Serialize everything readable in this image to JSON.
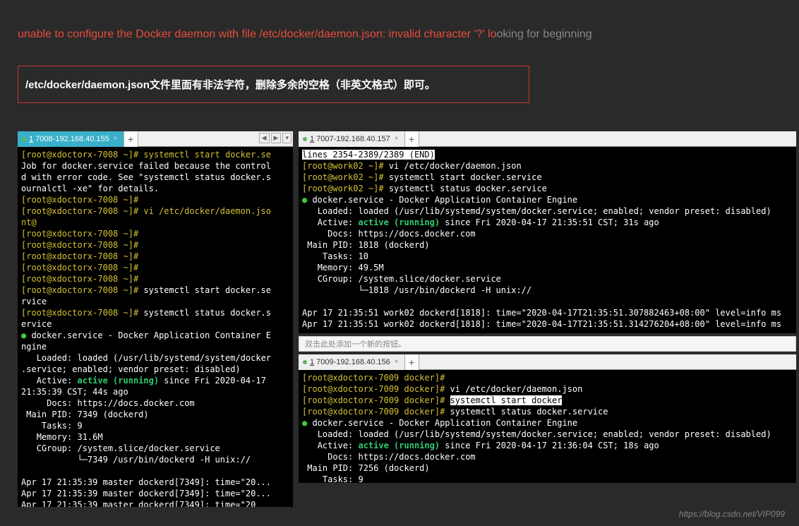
{
  "top": {
    "error_red": "unable to configure the Docker daemon with file /etc/docker/daemon.json: invalid character '?' lo",
    "error_gray": "oking for beginning",
    "solution": "/etc/docker/daemon.json文件里面有非法字符，删除多余的空格（非英文格式）即可。"
  },
  "tabs": {
    "left": {
      "num": "1",
      "label": "7008-192.168.40.155"
    },
    "topRight": {
      "num": "1",
      "label": "7007-192.168.40.157"
    },
    "bottomRight": {
      "num": "1",
      "label": "7009-192.168.40.156"
    },
    "add": "+",
    "close": "×",
    "hintBar": "双击此处添加一个新的按钮。"
  },
  "terminalLeft": {
    "lines": [
      {
        "t": "[root@xdoctorx-7008 ~]# systemctl start docker.se",
        "c": "yellow"
      },
      {
        "t": "Job for docker.service failed because the control",
        "c": ""
      },
      {
        "t": "d with error code. See \"systemctl status docker.s",
        "c": ""
      },
      {
        "t": "ournalctl -xe\" for details.",
        "c": ""
      },
      {
        "t": "[root@xdoctorx-7008 ~]#",
        "c": "yellow"
      },
      {
        "t": "[root@xdoctorx-7008 ~]# vi /etc/docker/daemon.jso",
        "c": "yellow"
      },
      {
        "t": "nt@",
        "c": "yellow"
      },
      {
        "t": "[root@xdoctorx-7008 ~]#",
        "c": "yellow"
      },
      {
        "t": "[root@xdoctorx-7008 ~]#",
        "c": "yellow"
      },
      {
        "t": "[root@xdoctorx-7008 ~]#",
        "c": "yellow"
      },
      {
        "t": "[root@xdoctorx-7008 ~]#",
        "c": "yellow"
      },
      {
        "t": "[root@xdoctorx-7008 ~]#",
        "c": "yellow"
      },
      {
        "seg": [
          {
            "t": "[root@xdoctorx-7008 ~]# ",
            "c": "yellow"
          },
          {
            "t": "systemctl start docker.se",
            "c": ""
          }
        ]
      },
      {
        "t": "rvice",
        "c": ""
      },
      {
        "seg": [
          {
            "t": "[root@xdoctorx-7008 ~]# ",
            "c": "yellow"
          },
          {
            "t": "systemctl status docker.s",
            "c": ""
          }
        ]
      },
      {
        "t": "ervice",
        "c": ""
      },
      {
        "seg": [
          {
            "t": "● ",
            "c": "green"
          },
          {
            "t": "docker.service - Docker Application Container E",
            "c": ""
          }
        ]
      },
      {
        "t": "ngine",
        "c": ""
      },
      {
        "t": "   Loaded: loaded (/usr/lib/systemd/system/docker",
        "c": ""
      },
      {
        "t": ".service; enabled; vendor preset: disabled)",
        "c": ""
      },
      {
        "seg": [
          {
            "t": "   Active: ",
            "c": ""
          },
          {
            "t": "active (running)",
            "c": "bold-green"
          },
          {
            "t": " since Fri 2020-04-17",
            "c": ""
          }
        ]
      },
      {
        "t": "21:35:39 CST; 44s ago",
        "c": ""
      },
      {
        "t": "     Docs: https://docs.docker.com",
        "c": ""
      },
      {
        "t": " Main PID: 7349 (dockerd)",
        "c": ""
      },
      {
        "t": "    Tasks: 9",
        "c": ""
      },
      {
        "t": "   Memory: 31.6M",
        "c": ""
      },
      {
        "t": "   CGroup: /system.slice/docker.service",
        "c": ""
      },
      {
        "t": "           └─7349 /usr/bin/dockerd -H unix://",
        "c": ""
      },
      {
        "t": "",
        "c": ""
      },
      {
        "t": "Apr 17 21:35:39 master dockerd[7349]: time=\"20...",
        "c": ""
      },
      {
        "t": "Apr 17 21:35:39 master dockerd[7349]: time=\"20...",
        "c": ""
      },
      {
        "t": "Apr 17 21:35:39 master dockerd[7349]: time=\"20",
        "c": ""
      }
    ]
  },
  "terminalTopRight": {
    "hl": "lines 2354-2389/2389 (END)",
    "lines": [
      {
        "seg": [
          {
            "t": "[root@work02 ~]# ",
            "c": "yellow"
          },
          {
            "t": "vi /etc/docker/daemon.json",
            "c": ""
          }
        ]
      },
      {
        "seg": [
          {
            "t": "[root@work02 ~]# ",
            "c": "yellow"
          },
          {
            "t": "systemctl start docker.service",
            "c": ""
          }
        ]
      },
      {
        "seg": [
          {
            "t": "[root@work02 ~]# ",
            "c": "yellow"
          },
          {
            "t": "systemctl status docker.service",
            "c": ""
          }
        ]
      },
      {
        "seg": [
          {
            "t": "● ",
            "c": "green"
          },
          {
            "t": "docker.service - Docker Application Container Engine",
            "c": ""
          }
        ]
      },
      {
        "t": "   Loaded: loaded (/usr/lib/systemd/system/docker.service; enabled; vendor preset: disabled)",
        "c": ""
      },
      {
        "seg": [
          {
            "t": "   Active: ",
            "c": ""
          },
          {
            "t": "active (running)",
            "c": "bold-green"
          },
          {
            "t": " since Fri 2020-04-17 21:35:51 CST; 31s ago",
            "c": ""
          }
        ]
      },
      {
        "t": "     Docs: https://docs.docker.com",
        "c": ""
      },
      {
        "t": " Main PID: 1818 (dockerd)",
        "c": ""
      },
      {
        "t": "    Tasks: 10",
        "c": ""
      },
      {
        "t": "   Memory: 49.5M",
        "c": ""
      },
      {
        "t": "   CGroup: /system.slice/docker.service",
        "c": ""
      },
      {
        "t": "           └─1818 /usr/bin/dockerd -H unix://",
        "c": ""
      },
      {
        "t": "",
        "c": ""
      },
      {
        "t": "Apr 17 21:35:51 work02 dockerd[1818]: time=\"2020-04-17T21:35:51.307882463+08:00\" level=info ms",
        "c": ""
      },
      {
        "t": "Apr 17 21:35:51 work02 dockerd[1818]: time=\"2020-04-17T21:35:51.314276204+08:00\" level=info ms",
        "c": ""
      }
    ]
  },
  "terminalBottomRight": {
    "lines": [
      {
        "t": "[root@xdoctorx-7009 docker]#",
        "c": "yellow"
      },
      {
        "seg": [
          {
            "t": "[root@xdoctorx-7009 docker]# ",
            "c": "yellow"
          },
          {
            "t": "vi /etc/docker/daemon.json",
            "c": ""
          }
        ]
      },
      {
        "seg": [
          {
            "t": "[root@xdoctorx-7009 docker]# ",
            "c": "yellow"
          },
          {
            "t": "systemctl start docker",
            "c": "",
            "hl": true
          }
        ]
      },
      {
        "seg": [
          {
            "t": "[root@xdoctorx-7009 docker]# ",
            "c": "yellow"
          },
          {
            "t": "systemctl status docker.service",
            "c": ""
          }
        ]
      },
      {
        "seg": [
          {
            "t": "● ",
            "c": "green"
          },
          {
            "t": "docker.service - Docker Application Container Engine",
            "c": ""
          }
        ]
      },
      {
        "t": "   Loaded: loaded (/usr/lib/systemd/system/docker.service; enabled; vendor preset: disabled)",
        "c": ""
      },
      {
        "seg": [
          {
            "t": "   Active: ",
            "c": ""
          },
          {
            "t": "active (running)",
            "c": "bold-green"
          },
          {
            "t": " since Fri 2020-04-17 21:36:04 CST; 18s ago",
            "c": ""
          }
        ]
      },
      {
        "t": "     Docs: https://docs.docker.com",
        "c": ""
      },
      {
        "t": " Main PID: 7256 (dockerd)",
        "c": ""
      },
      {
        "t": "    Tasks: 9",
        "c": ""
      }
    ]
  },
  "watermark": "https://blog.csdn.net/VIP099"
}
